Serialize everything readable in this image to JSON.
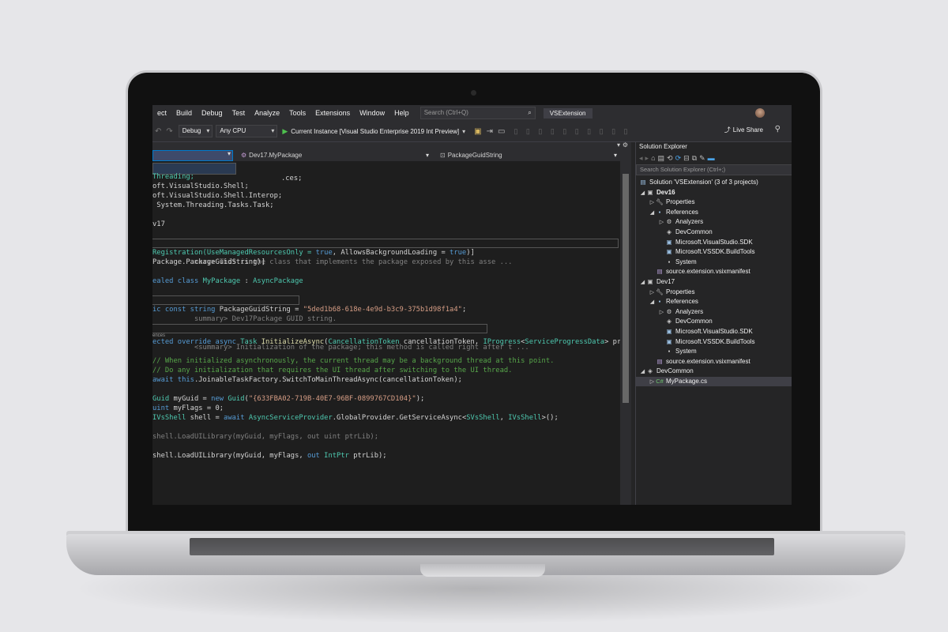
{
  "menu": {
    "items": [
      "ect",
      "Build",
      "Debug",
      "Test",
      "Analyze",
      "Tools",
      "Extensions",
      "Window",
      "Help"
    ],
    "search_placeholder": "Search (Ctrl+Q)",
    "solution_name": "VSExtension"
  },
  "toolbar": {
    "config": "Debug",
    "platform": "Any CPU",
    "run_target": "Current Instance [Visual Studio Enterprise 2019 Int Preview]",
    "live_share": "Live Share"
  },
  "nav": {
    "project": "Dev17.MyPackage",
    "member": "PackageGuidString"
  },
  "code": {
    "l1": ".ces;",
    "l2": "Threading;",
    "l3": "oft.VisualStudio.Shell;",
    "l4": "oft.VisualStudio.Shell.Interop;",
    "l5": " System.Threading.Tasks.Task;",
    "l6": "v17",
    "l7": "mary> This is the class that implements the package exposed by this asse ...",
    "l8a": "Registration(UseManagedResourcesOnly = ",
    "l8b": "true",
    "l8c": ", AllowsBackgroundLoading = ",
    "l8d": "true",
    "l8e": ")]",
    "l9": "Package.PackageGuidString)]",
    "l10a": "ealed class ",
    "l10b": "MyPackage",
    "l10c": " : ",
    "l10d": "AsyncPackage",
    "l11": "summary> Dev17Package GUID string.",
    "l12a": "ic const string ",
    "l12b": "PackageGuidString",
    "l12c": " = ",
    "l12d": "\"5ded1b68-618e-4e9d-b3c9-375b1d98f1a4\"",
    "l12e": ";",
    "l13": "<summary> Initialization of the package; this method is called right after t ...",
    "refs": "ences",
    "l14a": "ected override async ",
    "l14b": "Task",
    "l14c": " InitializeAsync",
    "l14d": "(",
    "l14e": "CancellationToken",
    "l14f": " cancellationToken, ",
    "l14g": "IProgress",
    "l14h": "<",
    "l14i": "ServiceProgressData",
    "l14j": "> pr",
    "l15": "// When initialized asynchronously, the current thread may be a background thread at this point.",
    "l16": "// Do any initialization that requires the UI thread after switching to the UI thread.",
    "l17a": "await ",
    "l17b": "this",
    "l17c": ".JoinableTaskFactory.SwitchToMainThreadAsync(cancellationToken);",
    "l18a": "Guid",
    "l18b": " myGuid = ",
    "l18c": "new ",
    "l18d": "Guid",
    "l18e": "(",
    "l18f": "\"{633FBA02-719B-40E7-96BF-0899767CD104}\"",
    "l18g": ");",
    "l19a": "uint",
    "l19b": " myFlags = 0;",
    "l20a": "IVsShell",
    "l20b": " shell = ",
    "l20c": "await ",
    "l20d": "AsyncServiceProvider",
    "l20e": ".GlobalProvider.GetServiceAsync<",
    "l20f": "SVsShell",
    "l20g": ", ",
    "l20h": "IVsShell",
    "l20i": ">();",
    "l21": "shell.LoadUILibrary(myGuid, myFlags, out uint ptrLib);",
    "l22a": "shell.LoadUILibrary(myGuid, myFlags, ",
    "l22b": "out ",
    "l22c": "IntPtr",
    "l22d": " ptrLib);"
  },
  "solution_explorer": {
    "title": "Solution Explorer",
    "search_placeholder": "Search Solution Explorer (Ctrl+;)",
    "tree": [
      {
        "label": "Solution 'VSExtension' (3 of 3 projects)",
        "icon": "solution-icon"
      },
      {
        "label": "Dev16",
        "icon": "csharp-project-icon"
      },
      {
        "label": "Properties",
        "icon": "wrench-icon"
      },
      {
        "label": "References",
        "icon": "references-icon"
      },
      {
        "label": "Analyzers",
        "icon": "analyzer-icon"
      },
      {
        "label": "DevCommon",
        "icon": "shared-project-icon"
      },
      {
        "label": "Microsoft.VisualStudio.SDK",
        "icon": "package-icon"
      },
      {
        "label": "Microsoft.VSSDK.BuildTools",
        "icon": "package-icon"
      },
      {
        "label": "System",
        "icon": "assembly-icon"
      },
      {
        "label": "source.extension.vsixmanifest",
        "icon": "manifest-icon"
      },
      {
        "label": "Dev17",
        "icon": "csharp-project-icon"
      },
      {
        "label": "Properties",
        "icon": "wrench-icon"
      },
      {
        "label": "References",
        "icon": "references-icon"
      },
      {
        "label": "Analyzers",
        "icon": "analyzer-icon"
      },
      {
        "label": "DevCommon",
        "icon": "shared-project-icon"
      },
      {
        "label": "Microsoft.VisualStudio.SDK",
        "icon": "package-icon"
      },
      {
        "label": "Microsoft.VSSDK.BuildTools",
        "icon": "package-icon"
      },
      {
        "label": "System",
        "icon": "assembly-icon"
      },
      {
        "label": "source.extension.vsixmanifest",
        "icon": "manifest-icon"
      },
      {
        "label": "DevCommon",
        "icon": "shared-project-icon"
      },
      {
        "label": "MyPackage.cs",
        "icon": "csharp-file-icon"
      }
    ]
  }
}
